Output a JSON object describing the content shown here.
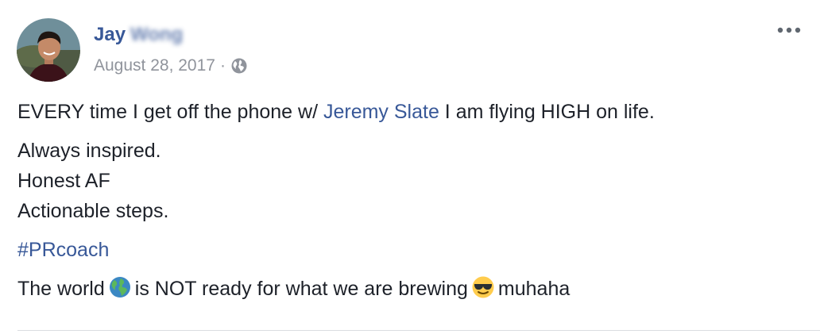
{
  "post": {
    "author": {
      "first_name": "Jay",
      "surname_blurred": "Wong"
    },
    "date": "August 28, 2017",
    "separator": "·",
    "privacy_icon": "globe-icon",
    "more_icon": "ellipsis-icon",
    "paragraphs": {
      "p1_before": "EVERY time I get off the phone w/ ",
      "p1_mention": "Jeremy Slate",
      "p1_after": " I am flying HIGH on life.",
      "p2_line1": "Always inspired.",
      "p2_line2": "Honest AF",
      "p2_line3": "Actionable steps.",
      "hashtag": "#PRcoach",
      "p4_before": "The world",
      "p4_middle": "is NOT ready for what we are brewing",
      "p4_after": "muhaha"
    },
    "emojis": [
      "earth-globe-emoji",
      "sunglasses-face-emoji"
    ]
  }
}
